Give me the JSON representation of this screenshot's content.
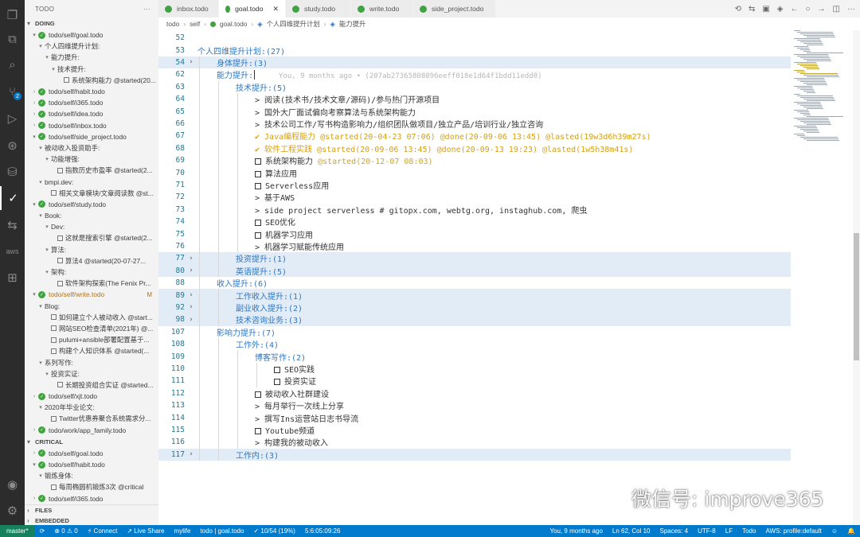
{
  "sidebar": {
    "title": "TODO",
    "more": "···",
    "sections": [
      {
        "label": "DOING"
      },
      {
        "label": "CRITICAL"
      }
    ],
    "doing": [
      {
        "t": "todo/self/goal.todo",
        "type": "file",
        "ind": 0,
        "tw": "▾"
      },
      {
        "t": "个人四维提升计划:",
        "type": "group",
        "ind": 1,
        "tw": "▾"
      },
      {
        "t": "能力提升:",
        "type": "group",
        "ind": 2,
        "tw": "▾"
      },
      {
        "t": "技术提升:",
        "type": "group",
        "ind": 3,
        "tw": "▾"
      },
      {
        "t": "系统架构能力 @started(20...",
        "type": "item",
        "ind": 4,
        "tw": ""
      },
      {
        "t": "todo/self/habit.todo",
        "type": "file",
        "ind": 0,
        "tw": "›"
      },
      {
        "t": "todo/self/i365.todo",
        "type": "file",
        "ind": 0,
        "tw": "›"
      },
      {
        "t": "todo/self/idea.todo",
        "type": "file",
        "ind": 0,
        "tw": "›"
      },
      {
        "t": "todo/self/inbox.todo",
        "type": "file",
        "ind": 0,
        "tw": "›"
      },
      {
        "t": "todo/self/side_project.todo",
        "type": "file",
        "ind": 0,
        "tw": "▾"
      },
      {
        "t": "被动收入投资助手:",
        "type": "group",
        "ind": 1,
        "tw": "▾"
      },
      {
        "t": "功能增强:",
        "type": "group",
        "ind": 2,
        "tw": "▾"
      },
      {
        "t": "指数历史市盈率 @started(2...",
        "type": "item",
        "ind": 3,
        "tw": ""
      },
      {
        "t": "bmpi.dev:",
        "type": "group",
        "ind": 1,
        "tw": "▾"
      },
      {
        "t": "相关文章模块/文章阅读数 @st...",
        "type": "item",
        "ind": 2,
        "tw": ""
      },
      {
        "t": "todo/self/study.todo",
        "type": "file",
        "ind": 0,
        "tw": "▾"
      },
      {
        "t": "Book:",
        "type": "group",
        "ind": 1,
        "tw": "▾"
      },
      {
        "t": "Dev:",
        "type": "group",
        "ind": 2,
        "tw": "▾"
      },
      {
        "t": "这就是搜索引擎 @started(2...",
        "type": "item",
        "ind": 3,
        "tw": ""
      },
      {
        "t": "算法:",
        "type": "group",
        "ind": 2,
        "tw": "▾"
      },
      {
        "t": "算法4 @started(20-07-27...",
        "type": "item",
        "ind": 3,
        "tw": ""
      },
      {
        "t": "架构:",
        "type": "group",
        "ind": 2,
        "tw": "▾"
      },
      {
        "t": "软件架构探索(The Fenix Pr...",
        "type": "item",
        "ind": 3,
        "tw": ""
      },
      {
        "t": "todo/self/write.todo",
        "type": "file-mod",
        "ind": 0,
        "tw": "▾",
        "badge": "M"
      },
      {
        "t": "Blog:",
        "type": "group",
        "ind": 1,
        "tw": "▾"
      },
      {
        "t": "如何建立个人被动收入 @start...",
        "type": "item",
        "ind": 2,
        "tw": ""
      },
      {
        "t": "网站SEO检查清单(2021年) @...",
        "type": "item",
        "ind": 2,
        "tw": ""
      },
      {
        "t": "pulumi+ansible部署配置基于...",
        "type": "item",
        "ind": 2,
        "tw": ""
      },
      {
        "t": "构建个人知识体系 @started(...",
        "type": "item",
        "ind": 2,
        "tw": ""
      },
      {
        "t": "系列写作:",
        "type": "group",
        "ind": 1,
        "tw": "▾"
      },
      {
        "t": "投资实证:",
        "type": "group",
        "ind": 2,
        "tw": "▾"
      },
      {
        "t": "长期投资组合实证 @started...",
        "type": "item",
        "ind": 3,
        "tw": ""
      },
      {
        "t": "todo/self/xjt.todo",
        "type": "file",
        "ind": 0,
        "tw": "›"
      },
      {
        "t": "2020年毕业论文:",
        "type": "group",
        "ind": 1,
        "tw": "▾"
      },
      {
        "t": "Twitter优惠券聚合系统需求分...",
        "type": "item",
        "ind": 2,
        "tw": ""
      },
      {
        "t": "todo/work/app_family.todo",
        "type": "file",
        "ind": 0,
        "tw": "›"
      }
    ],
    "critical": [
      {
        "t": "todo/self/goal.todo",
        "type": "file",
        "ind": 0,
        "tw": "›"
      },
      {
        "t": "todo/self/habit.todo",
        "type": "file",
        "ind": 0,
        "tw": "▾"
      },
      {
        "t": "锻炼身体:",
        "type": "group",
        "ind": 1,
        "tw": "▾"
      },
      {
        "t": "每周椭圆机锻炼3次 @critical",
        "type": "item",
        "ind": 2,
        "tw": ""
      },
      {
        "t": "todo/self/i365.todo",
        "type": "file",
        "ind": 0,
        "tw": "›"
      },
      {
        "t": "todo/self/idea.todo",
        "type": "file",
        "ind": 0,
        "tw": "›"
      }
    ],
    "bottom_sections": [
      "FILES",
      "EMBEDDED"
    ]
  },
  "tabs": [
    {
      "label": "inbox.todo",
      "active": false
    },
    {
      "label": "goal.todo",
      "active": true
    },
    {
      "label": "study.todo",
      "active": false
    },
    {
      "label": "write.todo",
      "active": false
    },
    {
      "label": "side_project.todo",
      "active": false
    }
  ],
  "breadcrumb": [
    "todo",
    "self",
    "goal.todo",
    "个人四维提升计划",
    "能力提升"
  ],
  "editor_lines": [
    {
      "n": "52",
      "lvl": 0,
      "fold": "",
      "hl": false,
      "parts": []
    },
    {
      "n": "53",
      "lvl": 0,
      "fold": "",
      "hl": false,
      "parts": [
        {
          "c": "c-proj",
          "t": "个人四维提升计划:(27)"
        }
      ]
    },
    {
      "n": "54",
      "lvl": 1,
      "fold": "›",
      "hl": true,
      "parts": [
        {
          "c": "c-proj",
          "t": "身体提升:(3)"
        }
      ]
    },
    {
      "n": "62",
      "lvl": 1,
      "fold": "",
      "hl": false,
      "parts": [
        {
          "c": "c-proj",
          "t": "能力提升:"
        }
      ],
      "blame": "You, 9 months ago • (207ab27365808896eeff018e1d64f1bdd11edd0)"
    },
    {
      "n": "63",
      "lvl": 2,
      "fold": "",
      "hl": false,
      "parts": [
        {
          "c": "c-proj",
          "t": "技术提升:(5)"
        }
      ]
    },
    {
      "n": "64",
      "lvl": 3,
      "fold": "",
      "hl": false,
      "parts": [
        {
          "c": "c-plain",
          "t": "> 阅读(技术书/技术文章/源码)/参与热门开源项目"
        }
      ]
    },
    {
      "n": "65",
      "lvl": 3,
      "fold": "",
      "hl": false,
      "parts": [
        {
          "c": "c-plain",
          "t": "> 国外大厂面试偏向考察算法与系统架构能力"
        }
      ]
    },
    {
      "n": "66",
      "lvl": 3,
      "fold": "",
      "hl": false,
      "parts": [
        {
          "c": "c-plain",
          "t": "> 技术公司工作/写书构造影响力/组织团队做项目/独立产品/培训行业/独立咨询"
        }
      ]
    },
    {
      "n": "67",
      "lvl": 3,
      "fold": "",
      "hl": false,
      "parts": [
        {
          "c": "c-done",
          "t": "✔ Java编程能力 @started(20-04-23 07:06) @done(20-09-06 13:45) @lasted(19w3d6h39m27s)"
        }
      ]
    },
    {
      "n": "68",
      "lvl": 3,
      "fold": "",
      "hl": false,
      "parts": [
        {
          "c": "c-done",
          "t": "✔ 软件工程实践 @started(20-09-06 13:45) @done(20-09-13 19:23) @lasted(1w5h38m41s)"
        }
      ]
    },
    {
      "n": "69",
      "lvl": 3,
      "fold": "",
      "hl": false,
      "box": true,
      "parts": [
        {
          "c": "c-plain",
          "t": "系统架构能力 "
        },
        {
          "c": "c-started",
          "t": "@started(20-12-07 08:03)"
        }
      ]
    },
    {
      "n": "70",
      "lvl": 3,
      "fold": "",
      "hl": false,
      "box": true,
      "parts": [
        {
          "c": "c-plain",
          "t": "算法应用"
        }
      ]
    },
    {
      "n": "71",
      "lvl": 3,
      "fold": "",
      "hl": false,
      "box": true,
      "parts": [
        {
          "c": "c-plain",
          "t": "Serverless应用"
        }
      ]
    },
    {
      "n": "72",
      "lvl": 3,
      "fold": "",
      "hl": false,
      "parts": [
        {
          "c": "c-plain",
          "t": "> 基于AWS"
        }
      ]
    },
    {
      "n": "73",
      "lvl": 3,
      "fold": "",
      "hl": false,
      "parts": [
        {
          "c": "c-plain",
          "t": "> side project serverless # gitopx.com, webtg.org, instaghub.com, 爬虫"
        }
      ]
    },
    {
      "n": "74",
      "lvl": 3,
      "fold": "",
      "hl": false,
      "box": true,
      "parts": [
        {
          "c": "c-plain",
          "t": "SEO优化"
        }
      ]
    },
    {
      "n": "75",
      "lvl": 3,
      "fold": "",
      "hl": false,
      "box": true,
      "parts": [
        {
          "c": "c-plain",
          "t": "机器学习应用"
        }
      ]
    },
    {
      "n": "76",
      "lvl": 3,
      "fold": "",
      "hl": false,
      "parts": [
        {
          "c": "c-plain",
          "t": "> 机器学习赋能传统应用"
        }
      ]
    },
    {
      "n": "77",
      "lvl": 2,
      "fold": "›",
      "hl": true,
      "parts": [
        {
          "c": "c-proj",
          "t": "投资提升:(1)"
        }
      ]
    },
    {
      "n": "80",
      "lvl": 2,
      "fold": "›",
      "hl": true,
      "parts": [
        {
          "c": "c-proj",
          "t": "英语提升:(5)"
        }
      ]
    },
    {
      "n": "88",
      "lvl": 1,
      "fold": "",
      "hl": false,
      "parts": [
        {
          "c": "c-proj",
          "t": "收入提升:(6)"
        }
      ]
    },
    {
      "n": "89",
      "lvl": 2,
      "fold": "›",
      "hl": true,
      "parts": [
        {
          "c": "c-proj",
          "t": "工作收入提升:(1)"
        }
      ]
    },
    {
      "n": "92",
      "lvl": 2,
      "fold": "›",
      "hl": true,
      "parts": [
        {
          "c": "c-proj",
          "t": "副业收入提升:(2)"
        }
      ]
    },
    {
      "n": "98",
      "lvl": 2,
      "fold": "›",
      "hl": true,
      "parts": [
        {
          "c": "c-proj",
          "t": "技术咨询业务:(3)"
        }
      ]
    },
    {
      "n": "107",
      "lvl": 1,
      "fold": "",
      "hl": false,
      "parts": [
        {
          "c": "c-proj",
          "t": "影响力提升:(7)"
        }
      ]
    },
    {
      "n": "108",
      "lvl": 2,
      "fold": "",
      "hl": false,
      "parts": [
        {
          "c": "c-proj",
          "t": "工作外:(4)"
        }
      ]
    },
    {
      "n": "109",
      "lvl": 3,
      "fold": "",
      "hl": false,
      "parts": [
        {
          "c": "c-proj",
          "t": "博客写作:(2)"
        }
      ]
    },
    {
      "n": "110",
      "lvl": 4,
      "fold": "",
      "hl": false,
      "box": true,
      "parts": [
        {
          "c": "c-plain",
          "t": "SEO实践"
        }
      ]
    },
    {
      "n": "111",
      "lvl": 4,
      "fold": "",
      "hl": false,
      "box": true,
      "parts": [
        {
          "c": "c-plain",
          "t": "投资实证"
        }
      ]
    },
    {
      "n": "112",
      "lvl": 3,
      "fold": "",
      "hl": false,
      "box": true,
      "parts": [
        {
          "c": "c-plain",
          "t": "被动收入社群建设"
        }
      ]
    },
    {
      "n": "113",
      "lvl": 3,
      "fold": "",
      "hl": false,
      "parts": [
        {
          "c": "c-plain",
          "t": "> 每月举行一次线上分享"
        }
      ]
    },
    {
      "n": "114",
      "lvl": 3,
      "fold": "",
      "hl": false,
      "parts": [
        {
          "c": "c-plain",
          "t": "> 撰写Ins运营站日志书导流"
        }
      ]
    },
    {
      "n": "115",
      "lvl": 3,
      "fold": "",
      "hl": false,
      "box": true,
      "parts": [
        {
          "c": "c-plain",
          "t": "Youtube频道"
        }
      ]
    },
    {
      "n": "116",
      "lvl": 3,
      "fold": "",
      "hl": false,
      "parts": [
        {
          "c": "c-plain",
          "t": "> 构建我的被动收入"
        }
      ]
    },
    {
      "n": "117",
      "lvl": 2,
      "fold": "›",
      "hl": true,
      "parts": [
        {
          "c": "c-proj",
          "t": "工作内:(3)"
        }
      ]
    }
  ],
  "watermark": {
    "text": "微信号: improve365"
  },
  "status": {
    "left": [
      "master*",
      "⟳",
      "⊗ 0 ⚠ 0",
      "⚡ Connect",
      "↗ Live Share",
      "mylife",
      "todo | goal.todo",
      "✓ 10/54 (19%)",
      "5:6:05:09:26"
    ],
    "right": [
      "You, 9 months ago",
      "Ln 62, Col 10",
      "Spaces: 4",
      "UTF-8",
      "LF",
      "Todo",
      "AWS: profile:default",
      "☺",
      "🔔"
    ]
  },
  "colors": {
    "accent": "#007acc",
    "project": "#2e76c0",
    "done": "#d4a017",
    "highlight": "#e1ecf7"
  }
}
